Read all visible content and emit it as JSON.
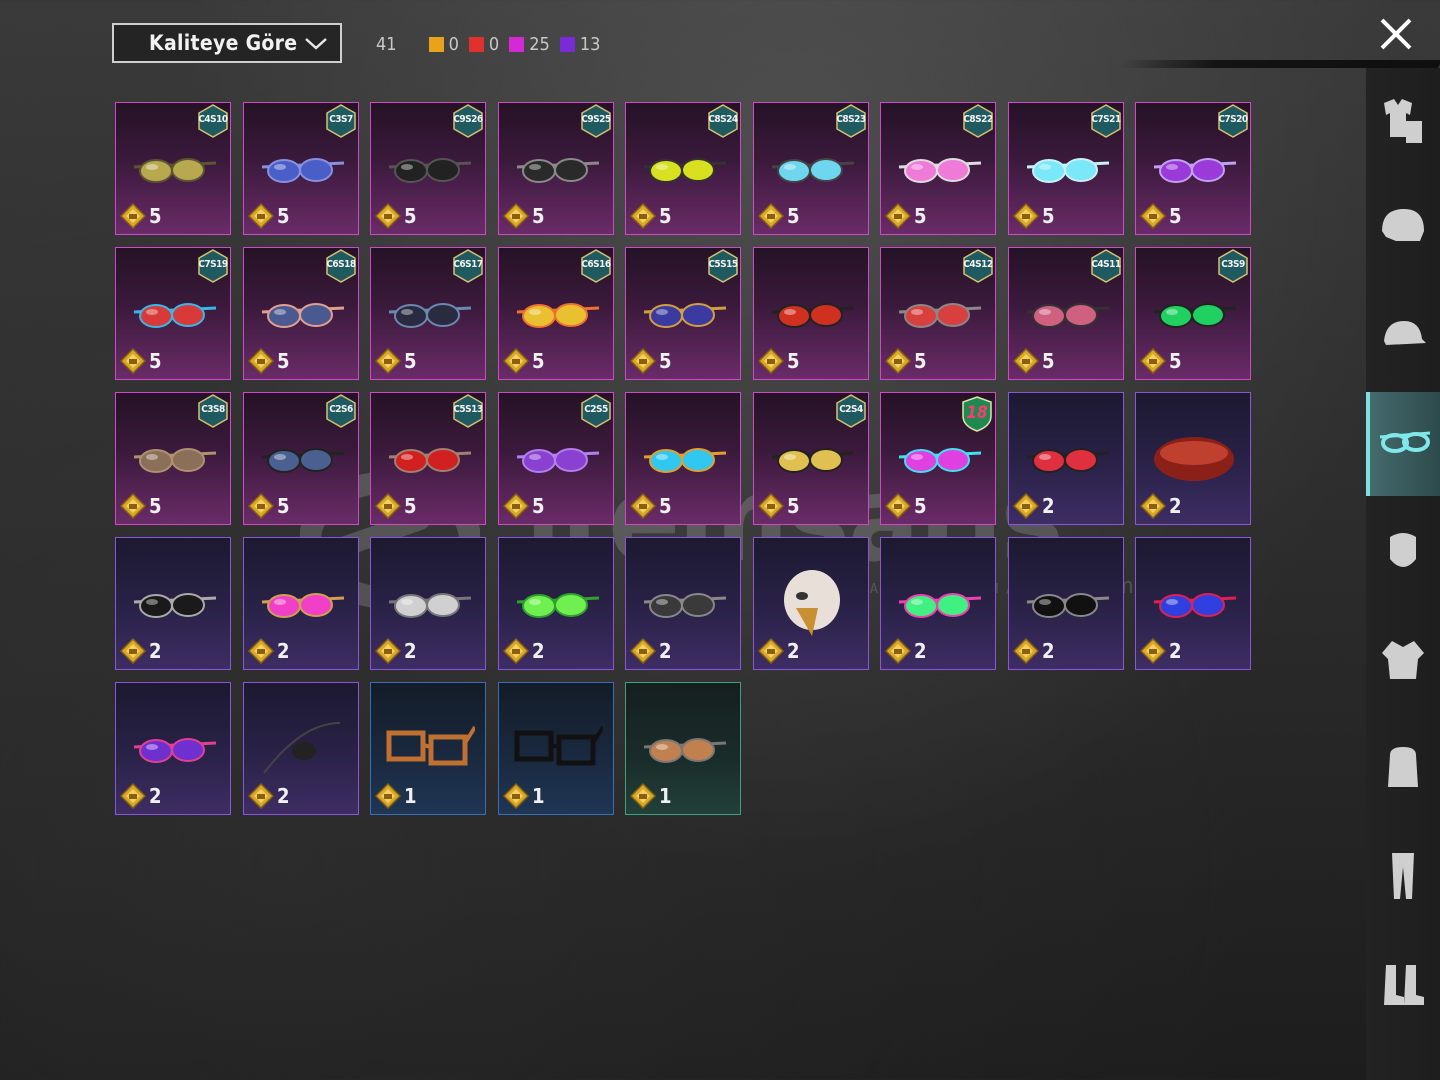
{
  "sort": {
    "label": "Kaliteye Göre"
  },
  "counts": {
    "total": "41",
    "quality": [
      {
        "color": "#e8a21c",
        "count": "0"
      },
      {
        "color": "#e0312f",
        "count": "0"
      },
      {
        "color": "#d42ad6",
        "count": "25"
      },
      {
        "color": "#7a2bd8",
        "count": "13"
      }
    ]
  },
  "items": [
    {
      "rarity": "legendary",
      "badge": "C4S10",
      "value": "5",
      "icon": "round-gold-glasses-icon"
    },
    {
      "rarity": "legendary",
      "badge": "C3S7",
      "value": "5",
      "icon": "masquerade-mask-icon"
    },
    {
      "rarity": "legendary",
      "badge": "C9S26",
      "value": "5",
      "icon": "thin-dark-glasses-icon"
    },
    {
      "rarity": "legendary",
      "badge": "C9S25",
      "value": "5",
      "icon": "black-sport-glasses-icon"
    },
    {
      "rarity": "legendary",
      "badge": "C8S24",
      "value": "5",
      "icon": "yellow-sport-glasses-icon"
    },
    {
      "rarity": "legendary",
      "badge": "C8S23",
      "value": "5",
      "icon": "blue-goggles-icon"
    },
    {
      "rarity": "legendary",
      "badge": "C8S22",
      "value": "5",
      "icon": "pink-shield-glasses-icon"
    },
    {
      "rarity": "legendary",
      "badge": "C7S21",
      "value": "5",
      "icon": "cyan-glasses-icon"
    },
    {
      "rarity": "legendary",
      "badge": "C7S20",
      "value": "5",
      "icon": "purple-glasses-icon"
    },
    {
      "rarity": "legendary",
      "badge": "C7S19",
      "value": "5",
      "icon": "donut-goggles-icon"
    },
    {
      "rarity": "legendary",
      "badge": "C6S18",
      "value": "5",
      "icon": "visor-glasses-icon"
    },
    {
      "rarity": "legendary",
      "badge": "C6S17",
      "value": "5",
      "icon": "tech-visor-icon"
    },
    {
      "rarity": "legendary",
      "badge": "C6S16",
      "value": "5",
      "icon": "gold-shield-glasses-icon"
    },
    {
      "rarity": "legendary",
      "badge": "C5S15",
      "value": "5",
      "icon": "round-blue-glasses-icon"
    },
    {
      "rarity": "legendary",
      "badge": "",
      "value": "5",
      "icon": "red-visor-icon"
    },
    {
      "rarity": "legendary",
      "badge": "C4S12",
      "value": "5",
      "icon": "heart-glasses-icon"
    },
    {
      "rarity": "legendary",
      "badge": "C4S11",
      "value": "5",
      "icon": "pink-wrap-glasses-icon"
    },
    {
      "rarity": "legendary",
      "badge": "C3S9",
      "value": "5",
      "icon": "green-goggles-icon"
    },
    {
      "rarity": "legendary",
      "badge": "C3S8",
      "value": "5",
      "icon": "brown-shades-icon"
    },
    {
      "rarity": "legendary",
      "badge": "C2S6",
      "value": "5",
      "icon": "gas-mask-goggles-icon"
    },
    {
      "rarity": "legendary",
      "badge": "C5S13",
      "value": "5",
      "icon": "red-round-glasses-icon"
    },
    {
      "rarity": "legendary",
      "badge": "C2S5",
      "value": "5",
      "icon": "purple-heart-glasses-icon"
    },
    {
      "rarity": "legendary",
      "badge": "",
      "value": "5",
      "icon": "cyan-ski-goggles-icon"
    },
    {
      "rarity": "legendary",
      "badge": "C2S4",
      "value": "5",
      "icon": "gold-cyber-glasses-icon"
    },
    {
      "rarity": "legendary",
      "badge": "18",
      "value": "5",
      "icon": "neon-visor-icon"
    },
    {
      "rarity": "epic",
      "badge": "",
      "value": "2",
      "icon": "red-small-glasses-icon"
    },
    {
      "rarity": "epic",
      "badge": "",
      "value": "2",
      "icon": "red-bandana-icon"
    },
    {
      "rarity": "epic",
      "badge": "",
      "value": "2",
      "icon": "aviator-black-glasses-icon"
    },
    {
      "rarity": "epic",
      "badge": "",
      "value": "2",
      "icon": "pink-round-glasses-icon"
    },
    {
      "rarity": "epic",
      "badge": "",
      "value": "2",
      "icon": "silver-mask-icon"
    },
    {
      "rarity": "epic",
      "badge": "",
      "value": "2",
      "icon": "lime-glasses-icon"
    },
    {
      "rarity": "epic",
      "badge": "",
      "value": "2",
      "icon": "tactical-glasses-icon"
    },
    {
      "rarity": "epic",
      "badge": "",
      "value": "2",
      "icon": "eagle-mask-icon"
    },
    {
      "rarity": "epic",
      "badge": "",
      "value": "2",
      "icon": "green-pink-visor-icon"
    },
    {
      "rarity": "epic",
      "badge": "",
      "value": "2",
      "icon": "black-wrap-glasses-icon"
    },
    {
      "rarity": "epic",
      "badge": "",
      "value": "2",
      "icon": "blue-frame-goggles-icon"
    },
    {
      "rarity": "epic",
      "badge": "",
      "value": "2",
      "icon": "purple-aviator-icon"
    },
    {
      "rarity": "epic",
      "badge": "",
      "value": "2",
      "icon": "eye-patch-icon"
    },
    {
      "rarity": "rare",
      "badge": "",
      "value": "1",
      "icon": "orange-square-glasses-icon"
    },
    {
      "rarity": "rare",
      "badge": "",
      "value": "1",
      "icon": "black-square-glasses-icon"
    },
    {
      "rarity": "common",
      "badge": "",
      "value": "1",
      "icon": "aviator-goggles-icon"
    }
  ],
  "sidebar": [
    {
      "icon": "outfit-icon",
      "active": false
    },
    {
      "icon": "helmet-icon",
      "active": false
    },
    {
      "icon": "cap-icon",
      "active": false
    },
    {
      "icon": "glasses-icon",
      "active": true
    },
    {
      "icon": "face-mask-icon",
      "active": false
    },
    {
      "icon": "jacket-icon",
      "active": false
    },
    {
      "icon": "backpack-icon",
      "active": false
    },
    {
      "icon": "pants-icon",
      "active": false
    },
    {
      "icon": "boots-icon",
      "active": false
    }
  ],
  "watermark": {
    "name": "itemsatis",
    "tagline": "HESAP / OYUN / ITEM / E-PIN",
    "domain": ".com"
  }
}
